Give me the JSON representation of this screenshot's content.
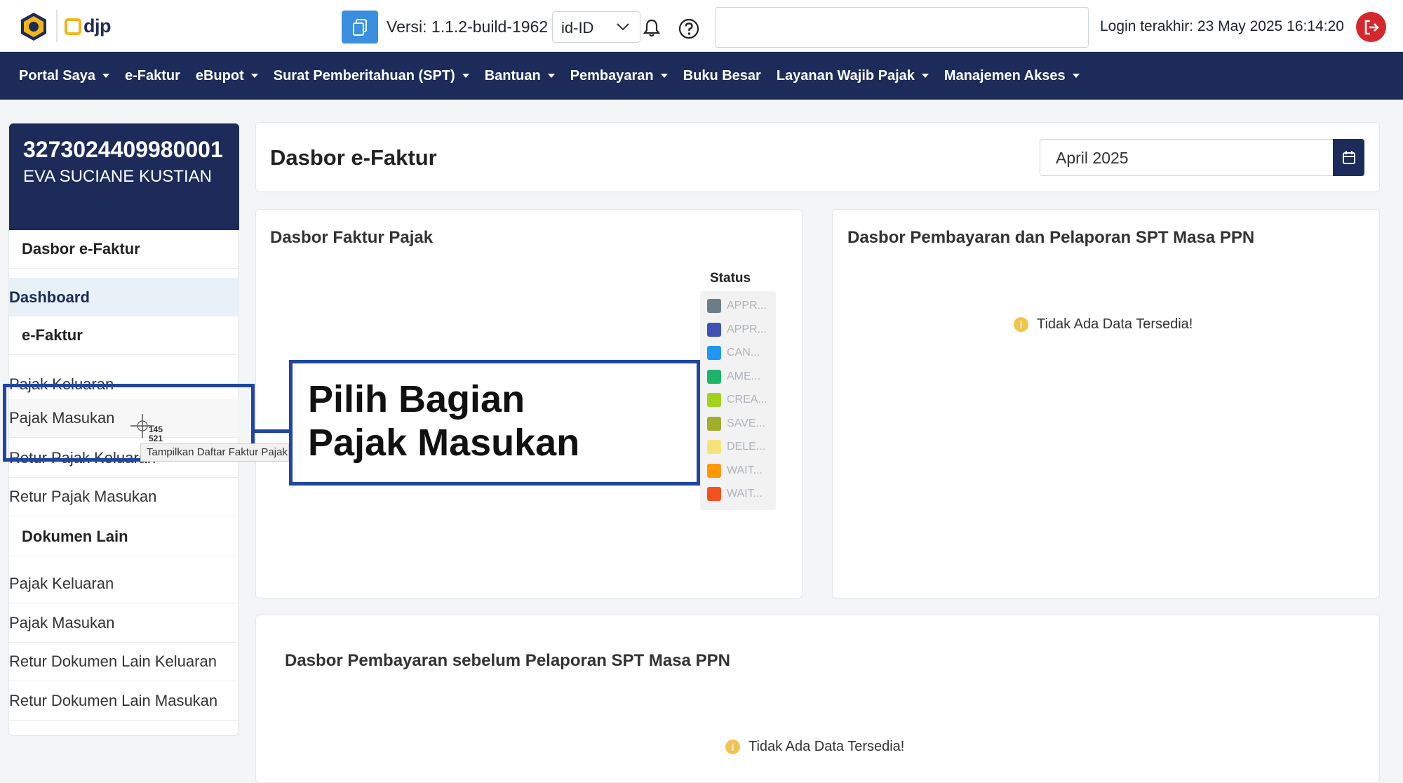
{
  "header": {
    "brand_text": "djp",
    "version_label": "Versi:",
    "version_value": "1.1.2-build-1962",
    "language": "id-ID",
    "login_label": "Login terakhir:",
    "login_value": "23 May 2025 16:14:20",
    "search_value": ""
  },
  "nav": {
    "items": [
      {
        "label": "Portal Saya",
        "dropdown": true
      },
      {
        "label": "e-Faktur",
        "dropdown": false
      },
      {
        "label": "eBupot",
        "dropdown": true
      },
      {
        "label": "Surat Pemberitahuan (SPT)",
        "dropdown": true
      },
      {
        "label": "Bantuan",
        "dropdown": true
      },
      {
        "label": "Pembayaran",
        "dropdown": true
      },
      {
        "label": "Buku Besar",
        "dropdown": false
      },
      {
        "label": "Layanan Wajib Pajak",
        "dropdown": true
      },
      {
        "label": "Manajemen Akses",
        "dropdown": true
      }
    ]
  },
  "profile": {
    "npwp": "3273024409980001",
    "name": "EVA SUCIANE KUSTIAN"
  },
  "sidebar": {
    "dasbor": "Dasbor e-Faktur",
    "dashboard": "Dashboard",
    "efaktur": "e-Faktur",
    "pajak_keluaran": "Pajak Keluaran",
    "pajak_masukan": "Pajak Masukan",
    "retur_pajak_keluaran": "Retur Pajak Keluaran",
    "retur_pajak_masukan": "Retur Pajak Masukan",
    "dokumen_lain": "Dokumen Lain",
    "dl_pajak_keluaran": "Pajak Keluaran",
    "dl_pajak_masukan": "Pajak Masukan",
    "dl_retur_keluaran": "Retur Dokumen Lain Keluaran",
    "dl_retur_masukan": "Retur Dokumen Lain Masukan"
  },
  "main": {
    "title": "Dasbor e-Faktur",
    "period": "April 2025",
    "faktur_title": "Dasbor Faktur Pajak",
    "legend_title": "Status",
    "legend": [
      {
        "label": "APPR...",
        "color": "#6b7d8a"
      },
      {
        "label": "APPR...",
        "color": "#3f51b5"
      },
      {
        "label": "CAN...",
        "color": "#2196f3"
      },
      {
        "label": "AME...",
        "color": "#1fb36a"
      },
      {
        "label": "CREA...",
        "color": "#a3d21c"
      },
      {
        "label": "SAVE...",
        "color": "#a2ad2a"
      },
      {
        "label": "DELE...",
        "color": "#f7e27a"
      },
      {
        "label": "WAIT...",
        "color": "#ff9800"
      },
      {
        "label": "WAIT...",
        "color": "#f4511e"
      }
    ],
    "spt_title": "Dasbor Pembayaran dan Pelaporan SPT Masa PPN",
    "spt_nodata": "Tidak Ada Data Tersedia!",
    "pre_title": "Dasbor Pembayaran sebelum Pelaporan SPT Masa PPN",
    "pre_nodata": "Tidak Ada Data Tersedia!"
  },
  "overlay": {
    "callout": "Pilih Bagian\nPajak Masukan",
    "tooltip": "Tampilkan Daftar Faktur Pajak",
    "coord_x": "145",
    "coord_y": "521"
  },
  "colors": {
    "navy": "#1c2b5a",
    "accent_blue": "#3a8fe0",
    "logout_red": "#d5282e",
    "highlight": "#1f46a0"
  }
}
